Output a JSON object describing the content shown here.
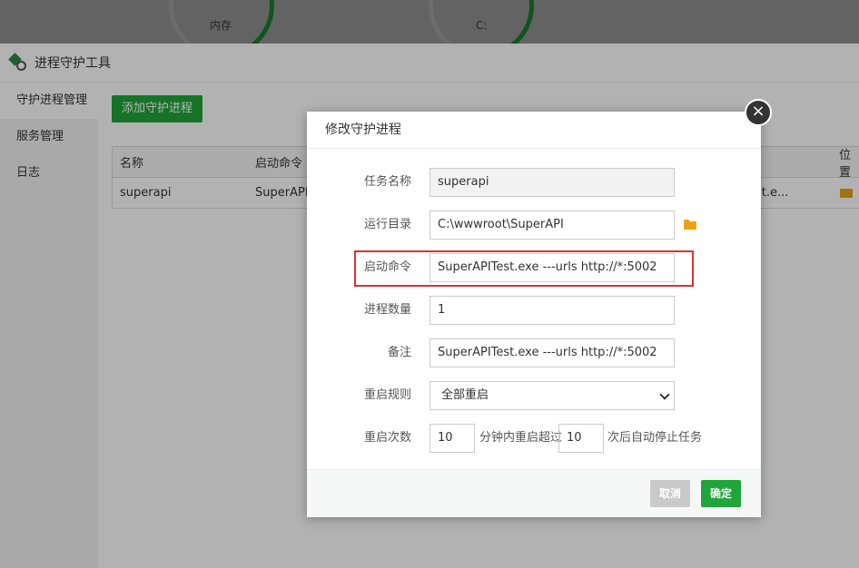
{
  "background": {
    "gauges": [
      {
        "label": "内存"
      },
      {
        "label": "C:"
      }
    ]
  },
  "page": {
    "title": "进程守护工具",
    "sidebar": {
      "items": [
        {
          "label": "守护进程管理",
          "active": true
        },
        {
          "label": "服务管理",
          "active": false
        },
        {
          "label": "日志",
          "active": false
        }
      ]
    },
    "add_button": "添加守护进程",
    "table": {
      "headers": [
        "名称",
        "启动命令",
        "位置"
      ],
      "row": {
        "name": "superapi",
        "command": "SuperAPIT",
        "location": "est.e..."
      }
    }
  },
  "modal": {
    "title": "修改守护进程",
    "close_symbol": "×",
    "fields": {
      "task_name": {
        "label": "任务名称",
        "value": "superapi"
      },
      "run_dir": {
        "label": "运行目录",
        "value": "C:\\wwwroot\\SuperAPI"
      },
      "start_cmd": {
        "label": "启动命令",
        "value": "SuperAPITest.exe ---urls http://*:5002"
      },
      "process_count": {
        "label": "进程数量",
        "value": "1"
      },
      "remark": {
        "label": "备注",
        "value": "SuperAPITest.exe ---urls http://*:5002"
      },
      "restart_rule": {
        "label": "重启规则",
        "value": "全部重启"
      },
      "restart_count": {
        "label": "重启次数",
        "minutes_value": "10",
        "middle_text": "分钟内重启超过",
        "times_value": "10",
        "suffix_text": "次后自动停止任务"
      }
    },
    "buttons": {
      "cancel": "取消",
      "ok": "确定"
    }
  },
  "colors": {
    "accent": "#20a53a",
    "highlight": "#d9342b"
  }
}
